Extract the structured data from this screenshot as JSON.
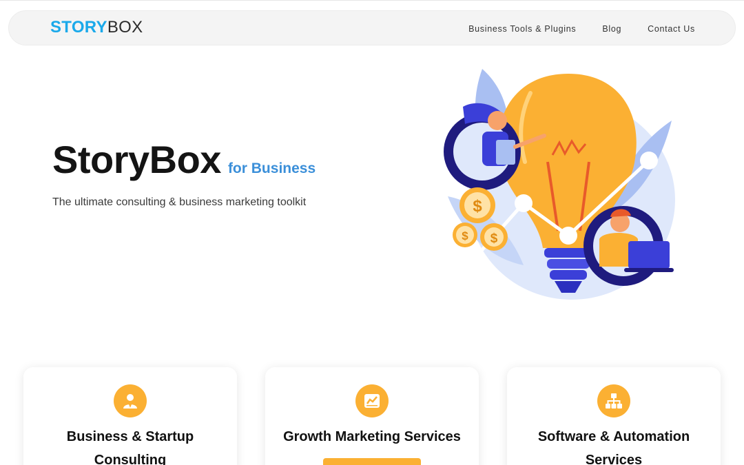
{
  "brand": {
    "logo_part1": "STORY",
    "logo_part2": "BOX",
    "logo_color_1": "#1aa9ea",
    "logo_color_2": "#2b2b2b"
  },
  "nav": {
    "items": [
      {
        "label": "Business Tools & Plugins"
      },
      {
        "label": "Blog"
      },
      {
        "label": "Contact Us"
      }
    ]
  },
  "hero": {
    "title": "StoryBox",
    "title_suffix": "for Business",
    "suffix_color": "#3b8fd9",
    "subtitle": "The ultimate consulting & business marketing toolkit",
    "illustration_icon": "lightbulb-growth-illustration"
  },
  "colors": {
    "accent": "#fbb033",
    "navy": "#1f1b7e",
    "light_blue": "#dfe8fb"
  },
  "services": [
    {
      "title": "Business & Startup Consulting",
      "icon": "user-icon"
    },
    {
      "title": "Growth Marketing Services",
      "icon": "chart-icon"
    },
    {
      "title": "Software & Automation Services",
      "icon": "sitemap-icon"
    }
  ]
}
